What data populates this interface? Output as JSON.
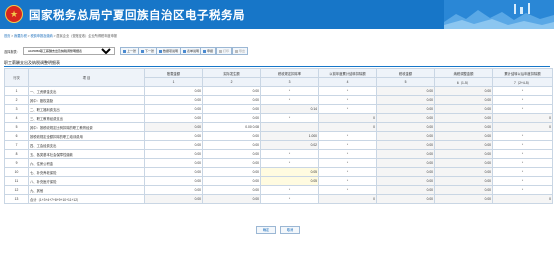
{
  "header": {
    "title": "国家税务总局宁夏回族自治区电子税务局"
  },
  "breadcrumb": {
    "items": [
      "首页",
      "我要办税",
      "税费申报及缴纳",
      "居民企业（查账征收）企业所得税年度申报"
    ],
    "separator": ">"
  },
  "toolbar": {
    "table_select_label": "选择报表:",
    "table_select_value": "A105050职工薪酬支出及纳税调整明细表",
    "buttons": [
      {
        "label": "上一张",
        "disabled": false
      },
      {
        "label": "下一张",
        "disabled": false
      },
      {
        "label": "数据项说明",
        "disabled": false
      },
      {
        "label": "表单说明",
        "disabled": false
      },
      {
        "label": "申报",
        "disabled": false
      },
      {
        "label": "打印",
        "disabled": true
      },
      {
        "label": "导出",
        "disabled": true
      }
    ]
  },
  "section": {
    "title": "职工薪酬支出及纳税调整明细表"
  },
  "table": {
    "headers": {
      "row_no": "行次",
      "item": "项 目",
      "cols": [
        "账载金额",
        "实际发生额",
        "税收规定扣除率",
        "以前年度累计结转扣除额",
        "税收金额",
        "纳税调整金额",
        "累计结转以后年度扣除额"
      ],
      "col_nums": [
        "1",
        "2",
        "3",
        "4",
        "5",
        "6（1-5）",
        "7（2+4-5）"
      ]
    },
    "rows": [
      {
        "no": "1",
        "item": "一、工资薪金支出",
        "c1": "0.00",
        "c2": "0.00",
        "c3": "*",
        "c4": "*",
        "c5": "0.00",
        "c6": "0.00",
        "c7": "*"
      },
      {
        "no": "2",
        "item": "其中：股权激励",
        "c1": "0.00",
        "c2": "0.00",
        "c3": "*",
        "c4": "*",
        "c5": "0.00",
        "c6": "0.00",
        "c7": "*"
      },
      {
        "no": "3",
        "item": "二、职工福利费支出",
        "c1": "0.00",
        "c2": "0.00",
        "c3": "0.14",
        "c4": "*",
        "c5": "0.00",
        "c6": "0.00",
        "c7": "*"
      },
      {
        "no": "4",
        "item": "三、职工教育经费支出",
        "c1": "0.00",
        "c2": "0.00",
        "c3": "*",
        "c4": "0",
        "c5": "0.00",
        "c6": "0.00",
        "c7": "0"
      },
      {
        "no": "5",
        "item": "其中：按税收规定比例扣除的职工教育经费",
        "c1": "0.00",
        "c2": "0.00 0.08",
        "c3": "",
        "c4": "0",
        "c5": "0.00",
        "c6": "0.00",
        "c7": "0"
      },
      {
        "no": "6",
        "item": "按税收规定全额扣除的职工培训费用",
        "c1": "0.00",
        "c2": "0.00",
        "c3": "1.000",
        "c4": "*",
        "c5": "0.00",
        "c6": "0.00",
        "c7": "*"
      },
      {
        "no": "7",
        "item": "四、工会经费支出",
        "c1": "0.00",
        "c2": "0.00",
        "c3": "0.02",
        "c4": "*",
        "c5": "0.00",
        "c6": "0.00",
        "c7": "*"
      },
      {
        "no": "8",
        "item": "五、各类基本社会保障性缴款",
        "c1": "0.00",
        "c2": "0.00",
        "c3": "*",
        "c4": "*",
        "c5": "0.00",
        "c6": "0.00",
        "c7": "*"
      },
      {
        "no": "9",
        "item": "六、住房公积金",
        "c1": "0.00",
        "c2": "0.00",
        "c3": "*",
        "c4": "*",
        "c5": "0.00",
        "c6": "0.00",
        "c7": "*"
      },
      {
        "no": "10",
        "item": "七、补充养老保险",
        "c1": "0.00",
        "c2": "0.00",
        "c3": "0.05",
        "c4": "*",
        "c5": "0.00",
        "c6": "0.00",
        "c7": "*"
      },
      {
        "no": "11",
        "item": "八、补充医疗保险",
        "c1": "0.00",
        "c2": "0.00",
        "c3": "0.05",
        "c4": "*",
        "c5": "0.00",
        "c6": "0.00",
        "c7": "*"
      },
      {
        "no": "12",
        "item": "九、其他",
        "c1": "0.00",
        "c2": "0.00",
        "c3": "*",
        "c4": "*",
        "c5": "0.00",
        "c6": "0.00",
        "c7": "*"
      },
      {
        "no": "13",
        "item": "合计（1+3+4+7+8+9+10+11+12）",
        "c1": "0.00",
        "c2": "0.00",
        "c3": "*",
        "c4": "0",
        "c5": "0.00",
        "c6": "0.00",
        "c7": "0"
      }
    ]
  },
  "footer": {
    "confirm_label": "确定",
    "cancel_label": "取消"
  },
  "colors": {
    "banner": "#1776c8",
    "link": "#1a6dbb",
    "grid_border": "#c9d6e4",
    "header_bg": "#eef3f9",
    "editable_bg": "#fffbe0"
  }
}
